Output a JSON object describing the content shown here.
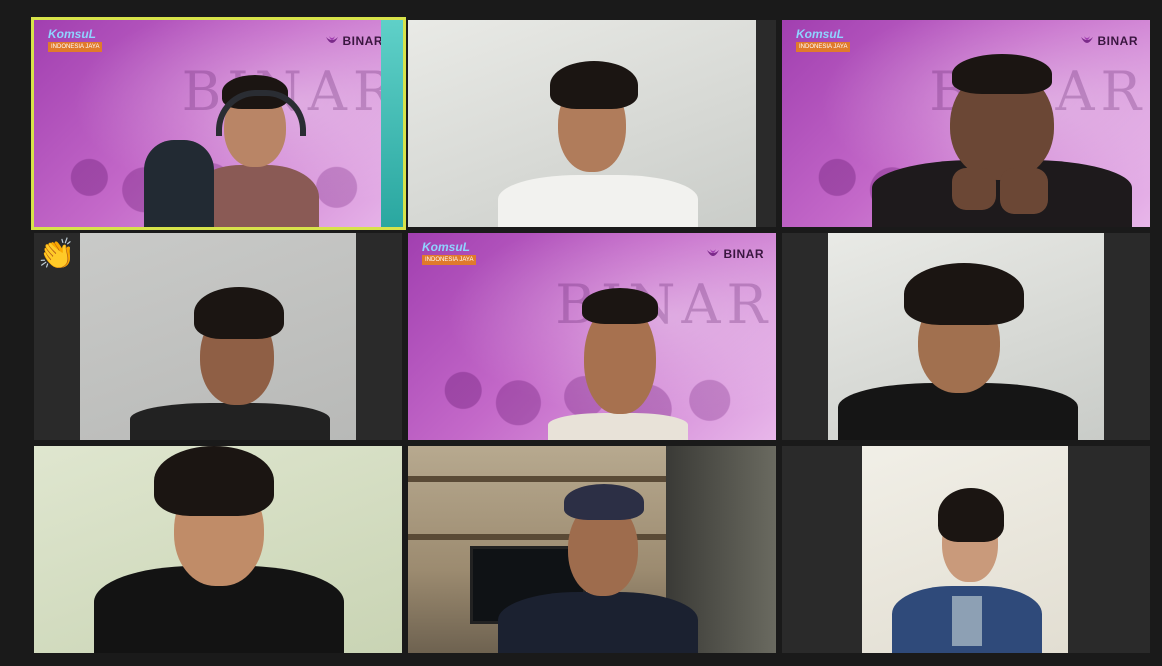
{
  "meeting": {
    "participants": [
      {
        "id": "p1",
        "background": "virtual",
        "active_speaker": true,
        "branding": {
          "event_title": "KomsuL",
          "event_subtitle": "INDONESIA JAYA",
          "logo_text": "BINAR"
        },
        "background_word": "BINAR"
      },
      {
        "id": "p2",
        "background": "wall"
      },
      {
        "id": "p3",
        "background": "virtual",
        "branding": {
          "event_title": "KomsuL",
          "event_subtitle": "INDONESIA JAYA",
          "logo_text": "BINAR"
        },
        "background_word": "BINAR"
      },
      {
        "id": "p4",
        "background": "grey-wall",
        "reaction": "👏"
      },
      {
        "id": "p5",
        "background": "virtual",
        "branding": {
          "event_title": "KomsuL",
          "event_subtitle": "INDONESIA JAYA",
          "logo_text": "BINAR"
        },
        "background_word": "BINAR"
      },
      {
        "id": "p6",
        "background": "wall"
      },
      {
        "id": "p7",
        "background": "green-wall"
      },
      {
        "id": "p8",
        "background": "room"
      },
      {
        "id": "p9",
        "background": "cream-wall"
      }
    ]
  },
  "colors": {
    "active_speaker_border": "#d7e34a",
    "app_background": "#1a1a1a",
    "brand_purple": "#a13fb0"
  }
}
